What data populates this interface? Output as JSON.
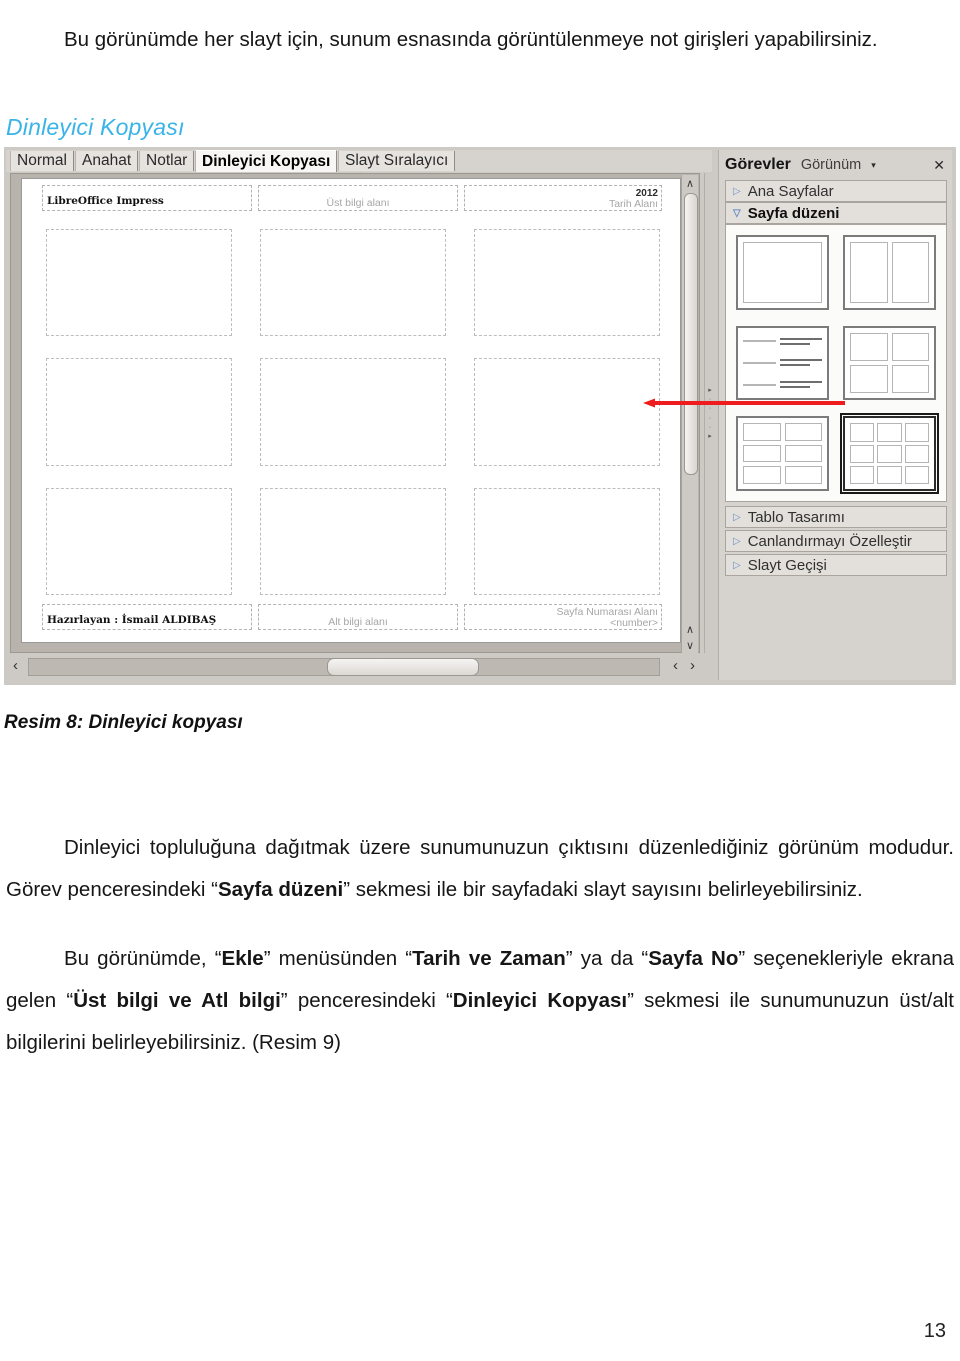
{
  "document": {
    "intro_paragraph": "Bu görünümde her slayt için, sunum esnasında görüntülenmeye not girişleri yapabilirsiniz.",
    "section_heading": "Dinleyici Kopyası",
    "figure_caption": "Resim 8: Dinleyici kopyası",
    "page_number": "13",
    "body_paragraph_1": {
      "t1": "Dinleyici topluluğuna dağıtmak üzere sunumunuzun çıktısını düzenlediğiniz görünüm modudur.  Görev penceresindeki “",
      "b1": "Sayfa düzeni",
      "t2": "” sekmesi ile bir sayfadaki slayt sayısını belirleyebilirsiniz."
    },
    "body_paragraph_2": {
      "t1": "Bu görünümde, “",
      "b1": "Ekle",
      "t2": "” menüsünden “",
      "b2": "Tarih ve Zaman",
      "t3": "” ya da “",
      "b3": "Sayfa No",
      "t4": "” seçenekleriyle ekrana gelen “",
      "b4": "Üst bilgi ve Atl bilgi",
      "t5": "” penceresindeki “",
      "b5": "Dinleyici Kopyası",
      "t6": "” sekmesi ile sunumunuzun üst/alt bilgilerini belirleyebilirsiniz. (Resim 9)"
    }
  },
  "app": {
    "view_tabs": [
      {
        "label": "Normal",
        "active": false
      },
      {
        "label": "Anahat",
        "active": false
      },
      {
        "label": "Notlar",
        "active": false
      },
      {
        "label": "Dinleyici Kopyası",
        "active": true
      },
      {
        "label": "Slayt Sıralayıcı",
        "active": false
      }
    ],
    "handout_page": {
      "header_left": "LibreOffice Impress",
      "header_center": "Üst bilgi alanı",
      "header_right_year": "2012",
      "header_right_label": "Tarih Alanı",
      "footer_left": "Hazırlayan : İsmail ALDIBAŞ",
      "footer_center": "Alt bilgi alanı",
      "footer_right_label": "Sayfa Numarası Alanı",
      "footer_right_field": "<number>",
      "slot_count": 9
    },
    "scroll": {
      "up_glyph": "∧",
      "down_glyph": "∨",
      "left_glyph": "‹",
      "right_glyph": "›"
    },
    "task_pane": {
      "title": "Görevler",
      "view_menu": "Görünüm",
      "caret_glyph": "▾",
      "close_glyph": "✕",
      "sections": [
        {
          "label": "Ana Sayfalar",
          "expanded": false,
          "glyph": "▷"
        },
        {
          "label": "Sayfa düzeni",
          "expanded": true,
          "glyph": "▽"
        }
      ],
      "layouts": [
        {
          "name": "bir-slayt",
          "kind": "one",
          "cells": 1,
          "selected": false
        },
        {
          "name": "iki-slayt",
          "kind": "two",
          "cells": 2,
          "selected": false
        },
        {
          "name": "anahat-notlu",
          "kind": "outline",
          "cells": 3,
          "selected": false
        },
        {
          "name": "dort-slayt",
          "kind": "four",
          "cells": 4,
          "selected": false
        },
        {
          "name": "alti-slayt",
          "kind": "six",
          "cells": 6,
          "selected": false
        },
        {
          "name": "dokuz-slayt",
          "kind": "nine",
          "cells": 9,
          "selected": true
        }
      ],
      "bottom_sections": [
        {
          "label": "Tablo Tasarımı",
          "glyph": "▷"
        },
        {
          "label": "Canlandırmayı Özelleştir",
          "glyph": "▷"
        },
        {
          "label": "Slayt Geçişi",
          "glyph": "▷"
        }
      ]
    }
  },
  "annotation": {
    "arrow_color": "#ee1c1c",
    "points_to": "dokuz-slayt"
  }
}
